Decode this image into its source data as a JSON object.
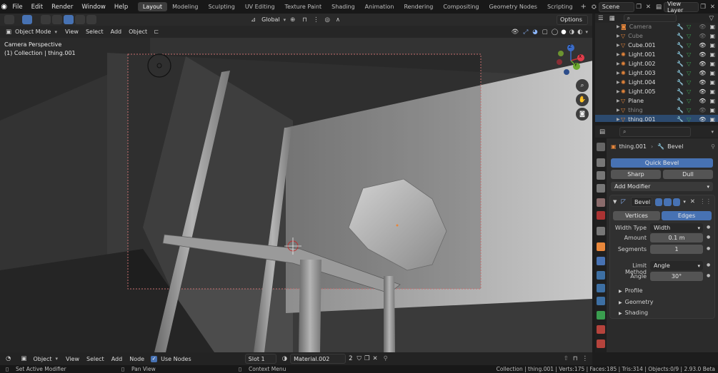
{
  "topbar": {
    "menus": [
      "File",
      "Edit",
      "Render",
      "Window",
      "Help"
    ],
    "workspaces": [
      "Layout",
      "Modeling",
      "Sculpting",
      "UV Editing",
      "Texture Paint",
      "Shading",
      "Animation",
      "Rendering",
      "Compositing",
      "Geometry Nodes",
      "Scripting"
    ],
    "active_workspace": "Layout",
    "scene": "Scene",
    "view_layer": "View Layer"
  },
  "toolbar": {
    "transform_orientation": "Global",
    "options": "Options"
  },
  "viewport_header": {
    "mode": "Object Mode",
    "menus": [
      "View",
      "Select",
      "Add",
      "Object"
    ]
  },
  "viewport": {
    "overlay_title": "Camera Perspective",
    "overlay_subtitle": "(1) Collection | thing.001"
  },
  "gizmo": {
    "x": "X",
    "y": "Y",
    "z": "Z"
  },
  "outliner": {
    "items": [
      {
        "name": "Camera",
        "faded": true
      },
      {
        "name": "Cube",
        "faded": true
      },
      {
        "name": "Cube.001",
        "faded": false
      },
      {
        "name": "Light.001",
        "faded": false
      },
      {
        "name": "Light.002",
        "faded": false
      },
      {
        "name": "Light.003",
        "faded": false
      },
      {
        "name": "Light.004",
        "faded": false
      },
      {
        "name": "Light.005",
        "faded": false
      },
      {
        "name": "Plane",
        "faded": false
      },
      {
        "name": "thing",
        "faded": true
      },
      {
        "name": "thing.001",
        "faded": false,
        "selected": true
      }
    ]
  },
  "properties": {
    "object_name": "thing.001",
    "modifier_breadcrumb": "Bevel",
    "quick_bevel": "Quick Bevel",
    "sharp": "Sharp",
    "dull": "Dull",
    "add_modifier": "Add Modifier",
    "modifier_name": "Bevel",
    "affect_vertices": "Vertices",
    "affect_edges": "Edges",
    "width_type_label": "Width Type",
    "width_type_value": "Width",
    "amount_label": "Amount",
    "amount_value": "0.1 m",
    "segments_label": "Segments",
    "segments_value": "1",
    "limit_method_label": "Limit Method",
    "limit_method_value": "Angle",
    "angle_label": "Angle",
    "angle_value": "30°",
    "panels": [
      "Profile",
      "Geometry",
      "Shading"
    ]
  },
  "node_header": {
    "object": "Object",
    "menus": [
      "View",
      "Select",
      "Add",
      "Node"
    ],
    "use_nodes": "Use Nodes",
    "slot": "Slot 1",
    "material": "Material.002",
    "users": "2"
  },
  "statusbar": {
    "left": "Set Active Modifier",
    "middle": "Pan View",
    "right_hint": "Context Menu",
    "stats": "Collection | thing.001 | Verts:175 | Faces:185 | Tris:314 | Objects:0/9 | 2.93.0 Beta"
  },
  "colors": {
    "accent": "#4772b3",
    "selection": "#2c4a6e",
    "orange": "#e8873b"
  }
}
